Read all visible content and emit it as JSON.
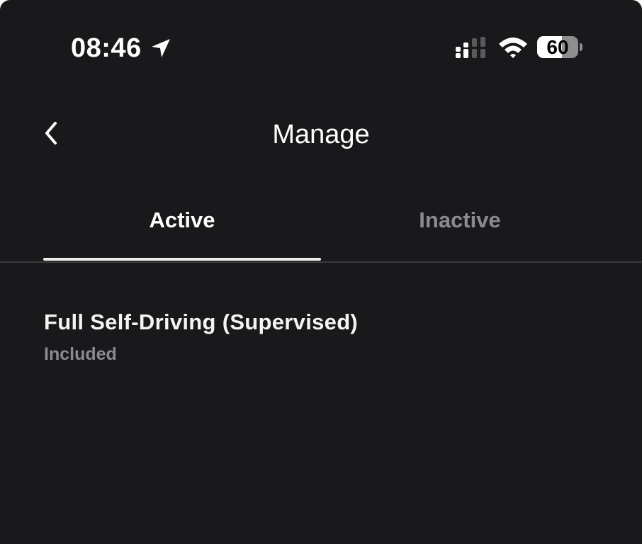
{
  "status_bar": {
    "time": "08:46",
    "battery_percent": 60,
    "battery_label": "60",
    "icons": [
      "location-arrow-icon",
      "cellular-signal-icon",
      "wifi-icon",
      "battery-icon"
    ]
  },
  "header": {
    "title": "Manage",
    "back_icon": "chevron-left-icon"
  },
  "tabs": [
    {
      "label": "Active",
      "selected": true
    },
    {
      "label": "Inactive",
      "selected": false
    }
  ],
  "features": [
    {
      "name": "Full Self-Driving (Supervised)",
      "status": "Included"
    }
  ],
  "colors": {
    "background": "#19191b",
    "text_primary": "#ffffff",
    "text_secondary": "#8b8b8e",
    "divider": "#3a3a3d"
  }
}
